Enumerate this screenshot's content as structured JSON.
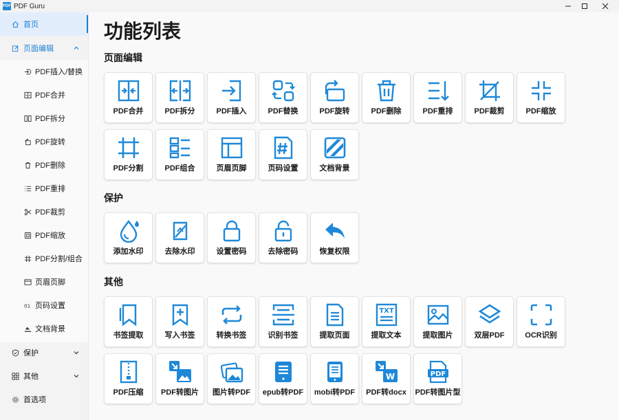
{
  "app": {
    "title": "PDF Guru",
    "logo_text": "PDF"
  },
  "sidebar": {
    "home": "首页",
    "page_edit": "页面编辑",
    "sub_items": [
      "PDF插入/替换",
      "PDF合并",
      "PDF拆分",
      "PDF旋转",
      "PDF删除",
      "PDF重排",
      "PDF裁剪",
      "PDF缩放",
      "PDF分割/组合",
      "页眉页脚",
      "页码设置",
      "文档背景"
    ],
    "protect": "保护",
    "other": "其他",
    "prefs": "首选项"
  },
  "main": {
    "title": "功能列表",
    "sections": [
      {
        "title": "页面编辑",
        "items": [
          "PDF合并",
          "PDF拆分",
          "PDF插入",
          "PDF替换",
          "PDF旋转",
          "PDF删除",
          "PDF重排",
          "PDF裁剪",
          "PDF缩放",
          "PDF分割",
          "PDF组合",
          "页眉页脚",
          "页码设置",
          "文档背景"
        ]
      },
      {
        "title": "保护",
        "items": [
          "添加水印",
          "去除水印",
          "设置密码",
          "去除密码",
          "恢复权限"
        ]
      },
      {
        "title": "其他",
        "items": [
          "书签提取",
          "写入书签",
          "转换书签",
          "识别书签",
          "提取页面",
          "提取文本",
          "提取图片",
          "双层PDF",
          "OCR识别",
          "PDF压缩",
          "PDF转图片",
          "图片转PDF",
          "epub转PDF",
          "mobi转PDF",
          "PDF转docx",
          "PDF转图片型"
        ]
      }
    ]
  },
  "colors": {
    "accent": "#1e7fd6",
    "icon": "#1e88d8"
  }
}
